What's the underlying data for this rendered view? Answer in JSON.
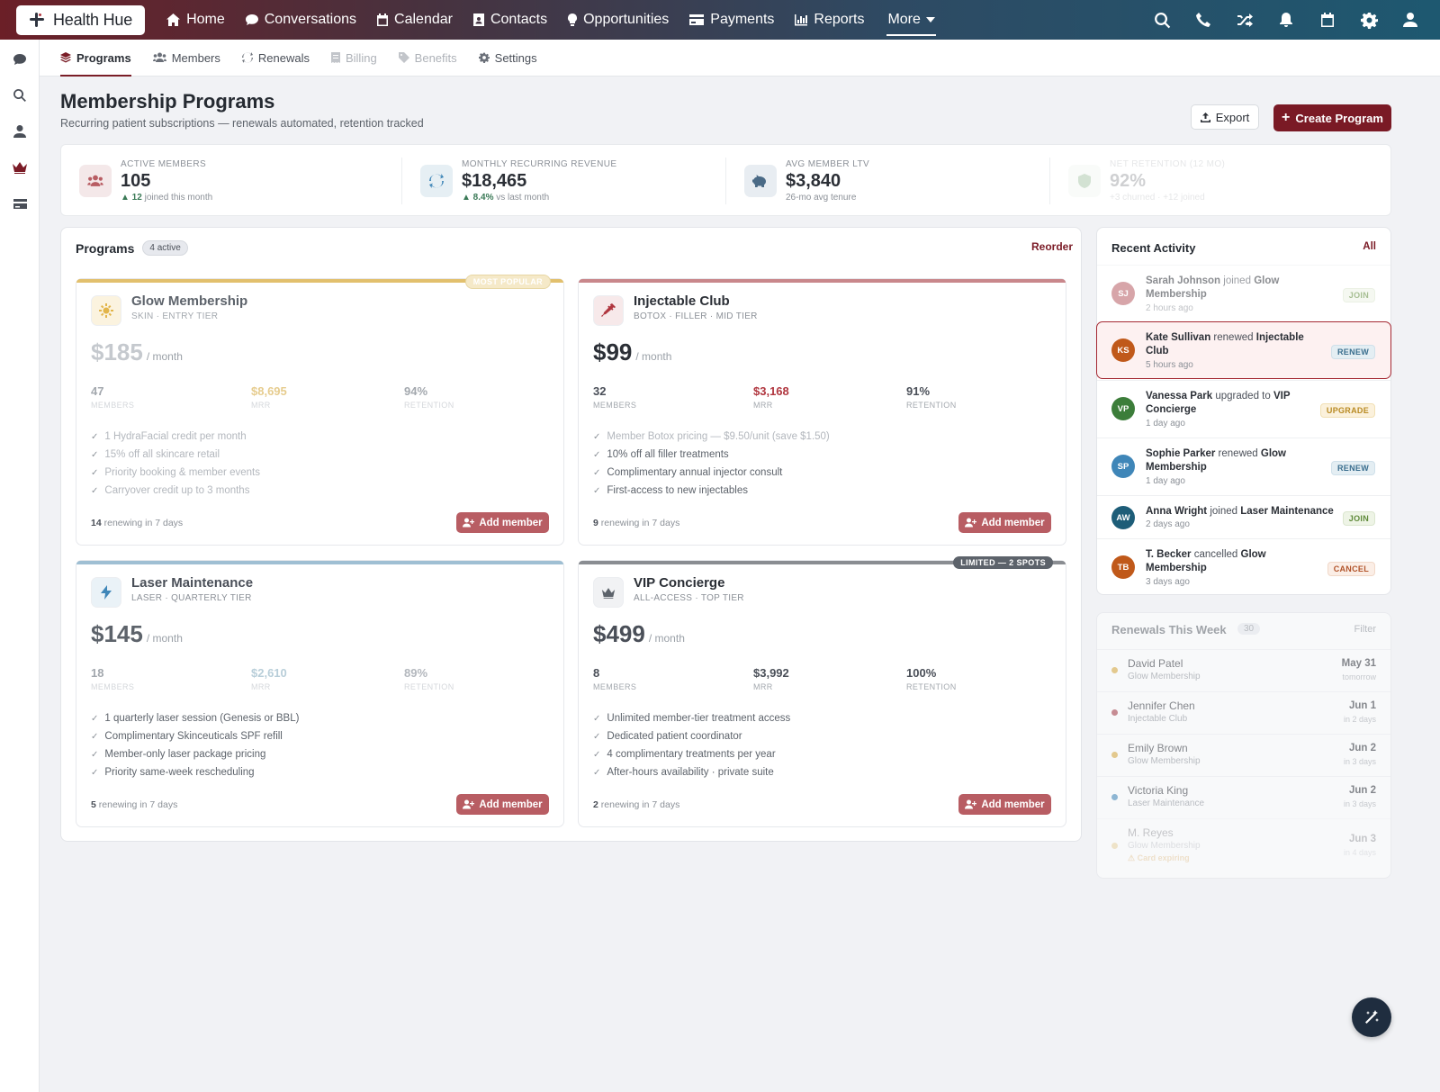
{
  "app": {
    "name": "Health Hue"
  },
  "topnav": {
    "home": "Home",
    "conversations": "Conversations",
    "calendar": "Calendar",
    "contacts": "Contacts",
    "opportunities": "Opportunities",
    "payments": "Payments",
    "reports": "Reports",
    "more": "More"
  },
  "subnav": {
    "programs": "Programs",
    "members": "Members",
    "renewals": "Renewals",
    "billing": "Billing",
    "benefits": "Benefits",
    "settings": "Settings"
  },
  "header": {
    "title": "Membership Programs",
    "subtitle": "Recurring patient subscriptions — renewals automated, retention tracked",
    "export_label": "Export",
    "create_label": "Create Program"
  },
  "stats": [
    {
      "label": "ACTIVE MEMBERS",
      "value": "105",
      "delta": "▲ 12",
      "note": "joined this month"
    },
    {
      "label": "MONTHLY RECURRING REVENUE",
      "value": "$18,465",
      "delta": "▲ 8.4%",
      "note": "vs last month"
    },
    {
      "label": "AVG MEMBER LTV",
      "value": "$3,840",
      "delta": "",
      "note": "26-mo avg tenure"
    },
    {
      "label": "NET RETENTION (12 MO)",
      "value": "92%",
      "delta": "",
      "note": "+3 churned · +12 joined"
    }
  ],
  "programs_panel": {
    "title": "Programs",
    "badge": "4 active",
    "reorder": "Reorder",
    "metric_labels": {
      "members": "MEMBERS",
      "mrr": "MRR",
      "retention": "RETENTION"
    },
    "add_member": "Add member",
    "renewing_suffix": "renewing in 7 days",
    "per_month": "/ month",
    "cards": [
      {
        "name": "Glow Membership",
        "tier": "SKIN · ENTRY TIER",
        "price": "$185",
        "members": "47",
        "mrr": "$8,695",
        "retention": "94%",
        "corner": "MOST POPULAR",
        "renewing": "14",
        "perks": [
          "1 HydraFacial credit per month",
          "15% off all skincare retail",
          "Priority booking & member events",
          "Carryover credit up to 3 months"
        ]
      },
      {
        "name": "Injectable Club",
        "tier": "BOTOX · FILLER · MID TIER",
        "price": "$99",
        "members": "32",
        "mrr": "$3,168",
        "retention": "91%",
        "corner": "",
        "renewing": "9",
        "perks": [
          "Member Botox pricing — $9.50/unit (save $1.50)",
          "10% off all filler treatments",
          "Complimentary annual injector consult",
          "First-access to new injectables"
        ]
      },
      {
        "name": "Laser Maintenance",
        "tier": "LASER · QUARTERLY TIER",
        "price": "$145",
        "members": "18",
        "mrr": "$2,610",
        "retention": "89%",
        "corner": "",
        "renewing": "5",
        "perks": [
          "1 quarterly laser session (Genesis or BBL)",
          "Complimentary Skinceuticals SPF refill",
          "Member-only laser package pricing",
          "Priority same-week rescheduling"
        ]
      },
      {
        "name": "VIP Concierge",
        "tier": "ALL-ACCESS · TOP TIER",
        "price": "$499",
        "members": "8",
        "mrr": "$3,992",
        "retention": "100%",
        "corner": "LIMITED — 2 SPOTS",
        "renewing": "2",
        "perks": [
          "Unlimited member-tier treatment access",
          "Dedicated patient coordinator",
          "4 complimentary treatments per year",
          "After-hours availability · private suite"
        ]
      }
    ]
  },
  "activity": {
    "title": "Recent Activity",
    "all": "All",
    "items": [
      {
        "initials": "SJ",
        "name": "Sarah Johnson",
        "verb": "joined",
        "program": "Glow Membership",
        "time": "2 hours ago",
        "tag": "JOIN",
        "color": "#b85d63"
      },
      {
        "initials": "KS",
        "name": "Kate Sullivan",
        "verb": "renewed",
        "program": "Injectable Club",
        "time": "5 hours ago",
        "tag": "RENEW",
        "color": "#c0591a"
      },
      {
        "initials": "VP",
        "name": "Vanessa Park",
        "verb": "upgraded to",
        "program": "VIP Concierge",
        "time": "1 day ago",
        "tag": "UPGRADE",
        "color": "#3c7d3a"
      },
      {
        "initials": "SP",
        "name": "Sophie Parker",
        "verb": "renewed",
        "program": "Glow Membership",
        "time": "1 day ago",
        "tag": "RENEW",
        "color": "#3f86b8"
      },
      {
        "initials": "AW",
        "name": "Anna Wright",
        "verb": "joined",
        "program": "Laser Maintenance",
        "time": "2 days ago",
        "tag": "JOIN",
        "color": "#1d5d78"
      },
      {
        "initials": "TB",
        "name": "T. Becker",
        "verb": "cancelled",
        "program": "Glow Membership",
        "time": "3 days ago",
        "tag": "CANCEL",
        "color": "#c0591a"
      }
    ]
  },
  "renewals": {
    "title": "Renewals This Week",
    "count": "30",
    "filter": "Filter",
    "items": [
      {
        "name": "David Patel",
        "program": "Glow Membership",
        "date": "May 31",
        "when": "tomorrow",
        "dot": "#d9a83a"
      },
      {
        "name": "Jennifer Chen",
        "program": "Injectable Club",
        "date": "Jun 1",
        "when": "in 2 days",
        "dot": "#a33a44"
      },
      {
        "name": "Emily Brown",
        "program": "Glow Membership",
        "date": "Jun 2",
        "when": "in 3 days",
        "dot": "#d9a83a"
      },
      {
        "name": "Victoria King",
        "program": "Laser Maintenance",
        "date": "Jun 2",
        "when": "in 3 days",
        "dot": "#3f86b8"
      },
      {
        "name": "M. Reyes",
        "program": "Glow Membership",
        "date": "Jun 3",
        "when": "in 4 days",
        "dot": "#d9a83a",
        "warning": "⚠ Card expiring"
      }
    ]
  }
}
